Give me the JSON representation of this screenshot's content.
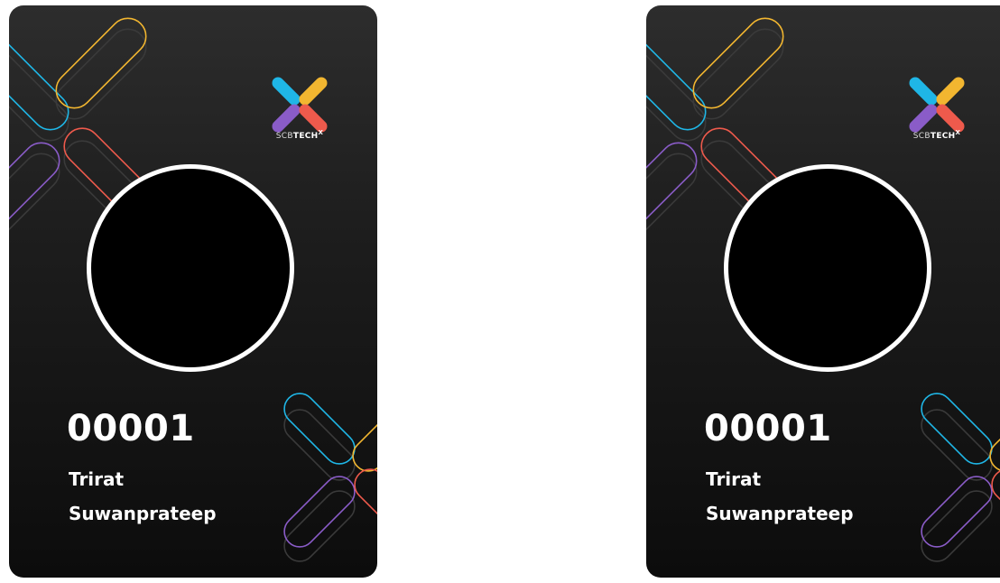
{
  "cards": [
    {
      "logo": {
        "icon": "scb-techx-logo-icon",
        "text_light": "SCB",
        "text_bold": "TECH",
        "text_sup": "X"
      },
      "photo": {
        "icon": "profile-photo-placeholder"
      },
      "employee_id": "00001",
      "first_name": "Trirat",
      "last_name": "Suwanprateep"
    },
    {
      "logo": {
        "icon": "scb-techx-logo-icon",
        "text_light": "SCB",
        "text_bold": "TECH",
        "text_sup": "X"
      },
      "photo": {
        "icon": "profile-photo-placeholder"
      },
      "employee_id": "00001",
      "first_name": "Trirat",
      "last_name": "Suwanprateep"
    }
  ],
  "colors": {
    "card_bg": "#1d1d1d",
    "blue": "#1fb6e6",
    "yellow": "#f2b630",
    "purple": "#8a5cc8",
    "red": "#ee5a4c",
    "ring": "#ffffff"
  }
}
